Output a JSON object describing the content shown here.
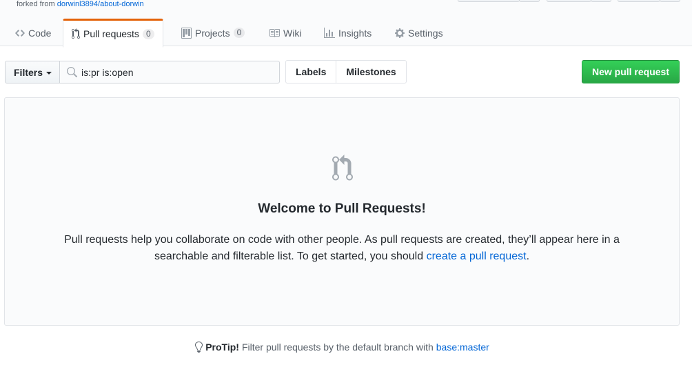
{
  "repo": {
    "forked_from_label": "forked from",
    "forked_from_link": "dorwinl3894/about-dorwin"
  },
  "tabs": [
    {
      "label": "Code",
      "icon": "code-icon"
    },
    {
      "label": "Pull requests",
      "icon": "git-pull-request-icon",
      "count": "0",
      "selected": true
    },
    {
      "label": "Projects",
      "icon": "project-icon",
      "count": "0"
    },
    {
      "label": "Wiki",
      "icon": "book-icon"
    },
    {
      "label": "Insights",
      "icon": "graph-icon"
    },
    {
      "label": "Settings",
      "icon": "gear-icon"
    }
  ],
  "subnav": {
    "filters_label": "Filters",
    "search_value": "is:pr is:open",
    "labels_label": "Labels",
    "milestones_label": "Milestones",
    "new_pr_label": "New pull request"
  },
  "blankslate": {
    "icon": "git-pull-request-icon",
    "title": "Welcome to Pull Requests!",
    "text": "Pull requests help you collaborate on code with other people. As pull requests are created, they’ll appear here in a searchable and filterable list. To get started, you should",
    "link": "create a pull request",
    "end": "."
  },
  "protip": {
    "icon": "light-bulb-icon",
    "strong": "ProTip!",
    "text": "Filter pull requests by the default branch with",
    "link": "base:master"
  },
  "colors": {
    "accent_tab": "#e36209",
    "primary_button": "#28a745",
    "link": "#0366d6"
  }
}
